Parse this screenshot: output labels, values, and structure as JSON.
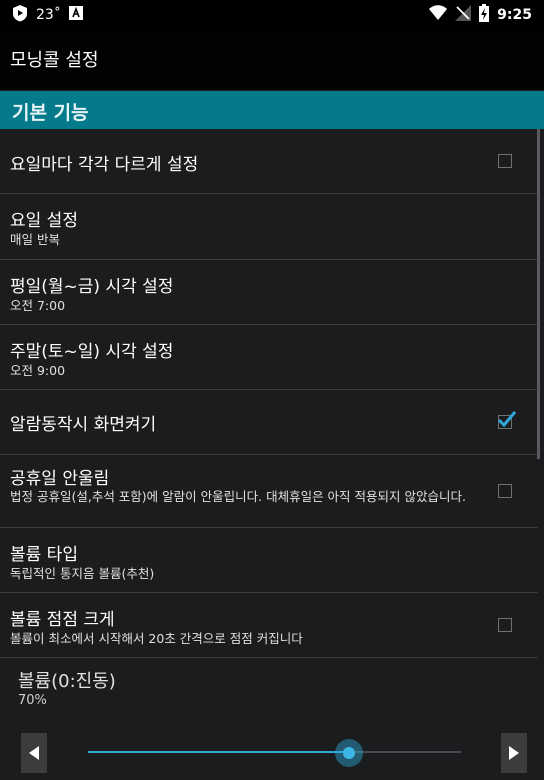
{
  "status_bar": {
    "temperature": "23˚",
    "time": "9:25",
    "icons": [
      "play-shield-icon",
      "a-badge-icon",
      "wifi-icon",
      "no-signal-icon",
      "battery-charging-icon"
    ]
  },
  "action_bar": {
    "title": "모닝콜 설정"
  },
  "category": {
    "title": "기본 기능"
  },
  "settings": [
    {
      "title": "요일마다 각각 다르게 설정",
      "checkbox": false
    },
    {
      "title": "요일 설정",
      "summary": "매일 반복"
    },
    {
      "title": "평일(월~금) 시각 설정",
      "summary": "오전 7:00"
    },
    {
      "title": "주말(토~일) 시각 설정",
      "summary": "오전 9:00"
    },
    {
      "title": "알람동작시 화면켜기",
      "checkbox": true
    },
    {
      "title": "공휴일 안울림",
      "summary": "법정 공휴일(설,추석 포함)에 알람이 안울립니다. 대체휴일은 아직 적용되지 않았습니다.",
      "checkbox": false
    },
    {
      "title": "볼륨 타입",
      "summary": "독립적인 통지음 볼륨(추천)"
    },
    {
      "title": "볼륨 점점 크게",
      "summary": "볼륨이 최소에서 시작해서 20초 간격으로 점점 커집니다",
      "checkbox": false
    }
  ],
  "volume": {
    "title": "볼륨(0:진동)",
    "value_label": "70%",
    "value": 0.7
  },
  "colors": {
    "accent": "#2fa9d9",
    "category_bg": "#047a8b",
    "background": "#1b1c1e"
  }
}
